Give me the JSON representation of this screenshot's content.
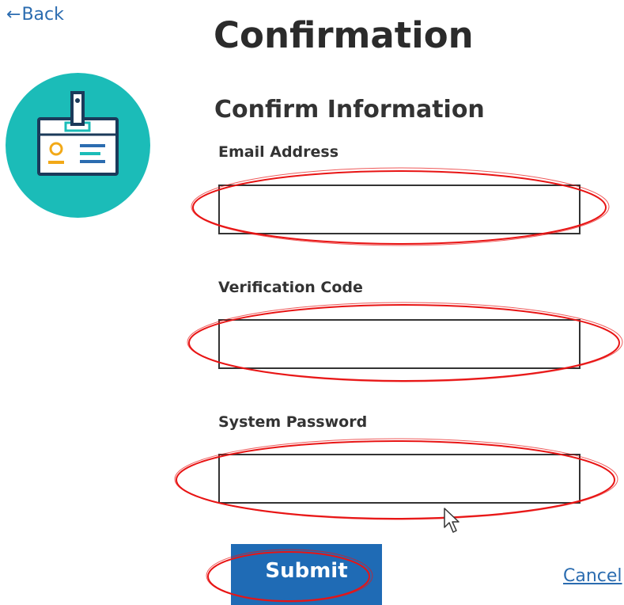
{
  "nav": {
    "back_label": "Back"
  },
  "header": {
    "title": "Confirmation",
    "section_title": "Confirm Information"
  },
  "form": {
    "fields": [
      {
        "label": "Email Address",
        "value": "",
        "placeholder": ""
      },
      {
        "label": "Verification Code",
        "value": "",
        "placeholder": ""
      },
      {
        "label": "System Password",
        "value": "",
        "placeholder": ""
      }
    ],
    "submit_label": "Submit",
    "cancel_label": "Cancel"
  },
  "icons": {
    "back": "left-arrow-icon",
    "illustration": "id-badge-icon",
    "cursor": "mouse-cursor-icon"
  },
  "colors": {
    "primary_blue": "#1f6bb5",
    "link_blue": "#2b6cb0",
    "badge_teal": "#1bbcb8",
    "badge_navy": "#1b3a5a",
    "badge_orange": "#f2a918",
    "annotation_red": "#e81414"
  }
}
